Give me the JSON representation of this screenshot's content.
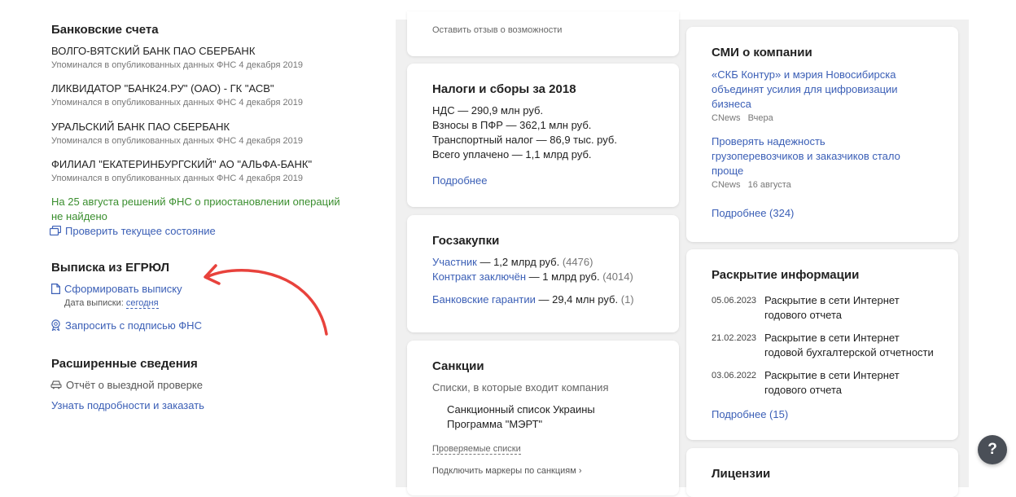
{
  "left": {
    "banks_title": "Банковские счета",
    "banks": [
      {
        "name": "ВОЛГО-ВЯТСКИЙ БАНК ПАО СБЕРБАНК",
        "note": "Упоминался в опубликованных данных ФНС 4 декабря 2019"
      },
      {
        "name": "ЛИКВИДАТОР \"БАНК24.РУ\" (ОАО) - ГК \"АСВ\"",
        "note": "Упоминался в опубликованных данных ФНС 4 декабря 2019"
      },
      {
        "name": "УРАЛЬСКИЙ БАНК ПАО СБЕРБАНК",
        "note": "Упоминался в опубликованных данных ФНС 4 декабря 2019"
      },
      {
        "name": "ФИЛИАЛ \"ЕКАТЕРИНБУРГСКИЙ\" АО \"АЛЬФА-БАНК\"",
        "note": "Упоминался в опубликованных данных ФНС 4 декабря 2019"
      }
    ],
    "fns_status_line1": "На 25 августа решений ФНС о приостановлении операций",
    "fns_status_line2": "не найдено",
    "check_state": "Проверить текущее состояние",
    "egrul_title": "Выписка из ЕГРЮЛ",
    "form_extract": "Сформировать выписку",
    "extract_date_label": "Дата выписки:",
    "extract_date_value": "сегодня",
    "request_signed": "Запросить с подписью ФНС",
    "extended_title": "Расширенные сведения",
    "onsite_report": "Отчёт о выездной проверке",
    "learn_order": "Узнать подробности и заказать"
  },
  "middle": {
    "feedback": "Оставить отзыв о возможности",
    "taxes": {
      "title": "Налоги и сборы за 2018",
      "lines": [
        "НДС — 290,9 млн руб.",
        "Взносы в ПФР — 362,1 млн руб.",
        "Транспортный налог — 86,9 тыс. руб.",
        "Всего уплачено — 1,1 млрд руб."
      ],
      "more": "Подробнее"
    },
    "procurement": {
      "title": "Госзакупки",
      "rows": [
        {
          "link": "Участник",
          "value": " — 1,2 млрд руб.",
          "count": "(4476)"
        },
        {
          "link": "Контракт заключён",
          "value": " — 1 млрд руб.",
          "count": "(4014)"
        },
        {
          "link": "Банковские гарантии",
          "value": " — 29,4 млн руб.",
          "count": "(1)"
        }
      ]
    },
    "sanctions": {
      "title": "Санкции",
      "subtitle": "Списки, в которые входит компания",
      "items": [
        "Санкционный список Украины",
        "Программа \"МЭРТ\""
      ],
      "checked_lists": "Проверяемые списки",
      "connect_markers": "Подключить маркеры по санкциям ›"
    }
  },
  "right": {
    "media": {
      "title": "СМИ о компании",
      "news": [
        {
          "lines": [
            "«СКБ Контур» и мэрия Новосибирска",
            "объединят усилия для цифровизации",
            "бизнеса"
          ],
          "source": "CNews",
          "date": "Вчера"
        },
        {
          "lines": [
            "Проверять надежность",
            "грузоперевозчиков и заказчиков стало",
            "проще"
          ],
          "source": "CNews",
          "date": "16 августа"
        }
      ],
      "more": "Подробнее (324)"
    },
    "disclosure": {
      "title": "Раскрытие информации",
      "items": [
        {
          "date": "05.06.2023",
          "lines": [
            "Раскрытие в сети Интернет",
            "годового отчета"
          ]
        },
        {
          "date": "21.02.2023",
          "lines": [
            "Раскрытие в сети Интернет",
            "годовой бухгалтерской отчетности"
          ]
        },
        {
          "date": "03.06.2022",
          "lines": [
            "Раскрытие в сети Интернет",
            "годового отчета"
          ]
        }
      ],
      "more": "Подробнее (15)"
    },
    "licenses": {
      "title": "Лицензии"
    }
  },
  "help": "?",
  "colors": {
    "link": "#3b5fb6",
    "green": "#3a8e2e",
    "arrow": "#e8423c",
    "help_bg": "#4a4f57"
  }
}
